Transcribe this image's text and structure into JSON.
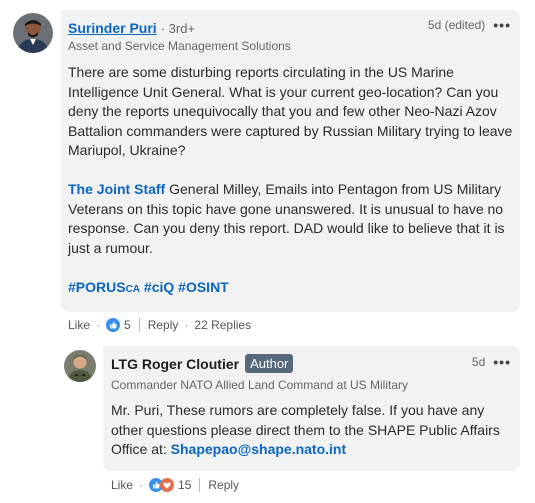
{
  "comment": {
    "author_name": "Surinder Puri",
    "degree": "· 3rd+",
    "headline": "Asset and Service Management Solutions",
    "time": "5d (edited)",
    "paragraph1": "There are some disturbing reports circulating in the US Marine Intelligence Unit General. What is your current geo-location? Can you deny the reports unequivocally that you and few other Neo-Nazi Azov Battalion commanders were captured by Russian Military trying to leave Mariupol, Ukraine?",
    "mention": "The Joint Staff",
    "paragraph2_rest": " General Milley, Emails into Pentagon from US Military Veterans on this topic have gone unanswered. It is unusual to have no response. Can you deny this report. DAD would like to believe that it is just a rumour.",
    "hashtag1": "#PORUS",
    "hashtag1_sub": "CA",
    "hashtag2": "#ciQ",
    "hashtag3": "#OSINT",
    "like_label": "Like",
    "reaction_count": "5",
    "reply_label": "Reply",
    "replies_label": "22 Replies"
  },
  "reply": {
    "author_name": "LTG Roger Cloutier",
    "badge": "Author",
    "headline": "Commander NATO Allied Land Command at US Military",
    "time": "5d",
    "text_before": "Mr. Puri, These rumors are completely false. If you have any other questions please direct them to the SHAPE Public Affairs Office at: ",
    "email": "Shapepao@shape.nato.int",
    "like_label": "Like",
    "reaction_count": "15",
    "reply_label": "Reply"
  },
  "icons": {
    "more": "ellipsis-icon",
    "like_reaction": "thumbs-up-icon",
    "love_reaction": "heart-icon"
  },
  "colors": {
    "link": "#0a66c2",
    "bubble": "#f2f2f2",
    "badge": "#56687a"
  }
}
